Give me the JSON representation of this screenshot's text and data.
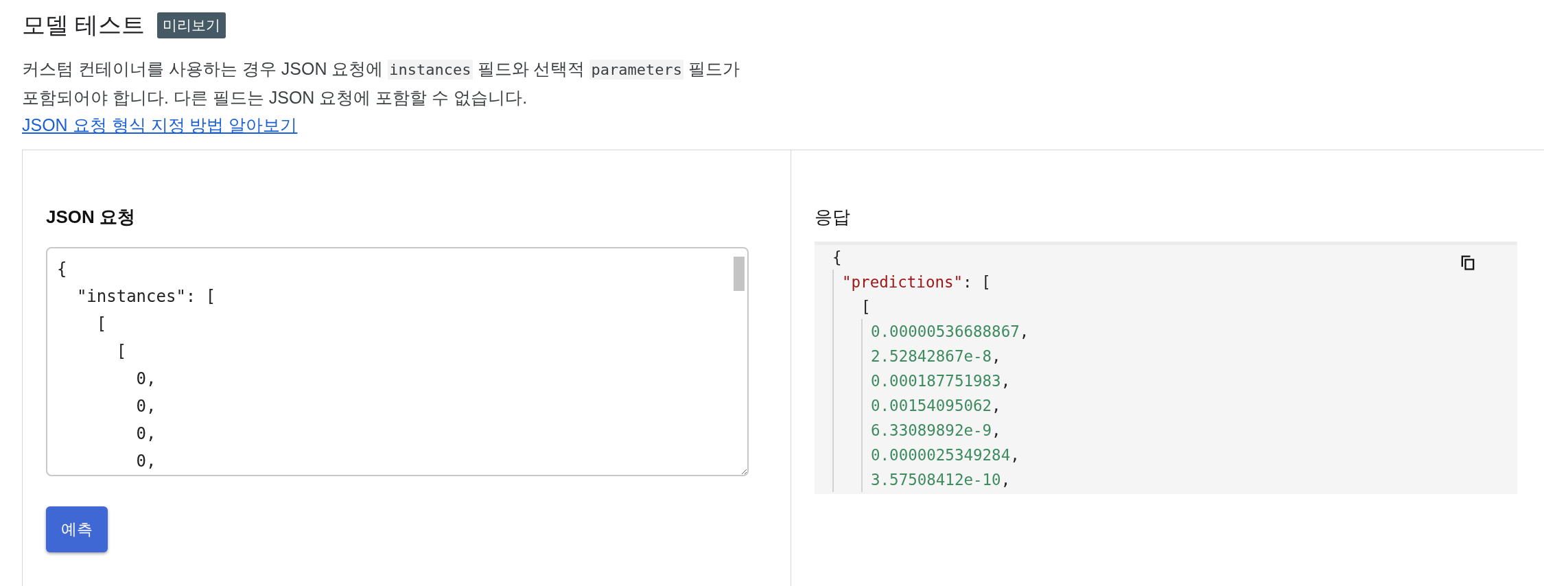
{
  "header": {
    "title": "모델 테스트",
    "badge": "미리보기"
  },
  "description": [
    {
      "kind": "text",
      "text": "커스텀 컨테이너를 사용하는 경우 JSON 요청에 "
    },
    {
      "kind": "code",
      "text": "instances"
    },
    {
      "kind": "text",
      "text": " 필드와 선택적 "
    },
    {
      "kind": "code",
      "text": "parameters"
    },
    {
      "kind": "text",
      "text": " 필드가 포함되어야 합니다. 다른 필드는 JSON 요청에 포함할 수 없습니다. "
    },
    {
      "kind": "link",
      "text": "JSON 요청 형식 지정 방법 알아보기"
    }
  ],
  "request": {
    "heading": "JSON 요청",
    "value": "{\n  \"instances\": [\n    [\n      [\n        0,\n        0,\n        0,\n        0,",
    "button": "예측"
  },
  "response": {
    "heading": "응답",
    "body": {
      "text": "{",
      "children": [
        {
          "key": "\"predictions\"",
          "text": ": [",
          "children": [
            {
              "text": "[",
              "children": [
                {
                  "number": "0.00000536688867",
                  "text": ","
                },
                {
                  "number": "2.52842867e-8",
                  "text": ","
                },
                {
                  "number": "0.000187751983",
                  "text": ","
                },
                {
                  "number": "0.00154095062",
                  "text": ","
                },
                {
                  "number": "6.33089892e-9",
                  "text": ","
                },
                {
                  "number": "0.0000025349284",
                  "text": ","
                },
                {
                  "number": "3.57508412e-10",
                  "text": ","
                }
              ]
            }
          ]
        }
      ]
    }
  }
}
